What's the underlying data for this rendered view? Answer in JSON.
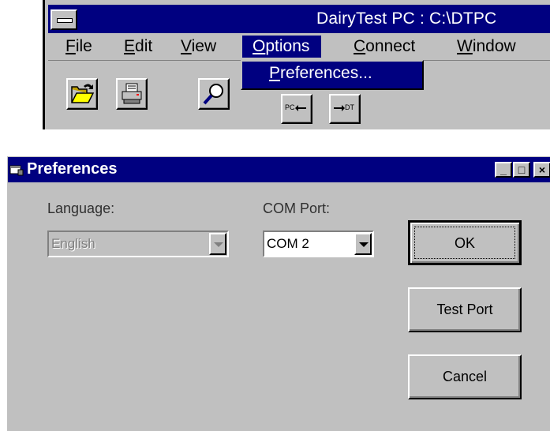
{
  "app": {
    "title": "DairyTest PC : C:\\DTPC",
    "menu": [
      {
        "label": "File",
        "mnemonic": "F",
        "rest": "ile"
      },
      {
        "label": "Edit",
        "mnemonic": "E",
        "rest": "dit"
      },
      {
        "label": "View",
        "mnemonic": "V",
        "rest": "iew"
      },
      {
        "label": "Options",
        "mnemonic": "O",
        "rest": "ptions"
      },
      {
        "label": "Connect",
        "mnemonic": "C",
        "rest": "onnect"
      },
      {
        "label": "Window",
        "mnemonic": "W",
        "rest": "indow"
      }
    ],
    "submenu_item": {
      "mnemonic": "P",
      "rest": "references..."
    },
    "toolbar": [
      {
        "name": "open-folder-icon"
      },
      {
        "name": "printer-icon"
      },
      {
        "name": "magnifier-icon"
      },
      {
        "name": "pc-transfer-icon",
        "text": "PC"
      },
      {
        "name": "dt-transfer-icon",
        "text": "DT"
      }
    ]
  },
  "dialog": {
    "title": "Preferences",
    "language_label": "Language:",
    "language_value": "English",
    "com_label": "COM Port:",
    "com_value": "COM 2",
    "ok_label": "OK",
    "test_port_label": "Test Port",
    "cancel_label": "Cancel",
    "caption_buttons": {
      "minimize": "_",
      "maximize": "□",
      "close": "×"
    }
  },
  "colors": {
    "titlebar": "#000080",
    "face": "#c0c0c0"
  }
}
